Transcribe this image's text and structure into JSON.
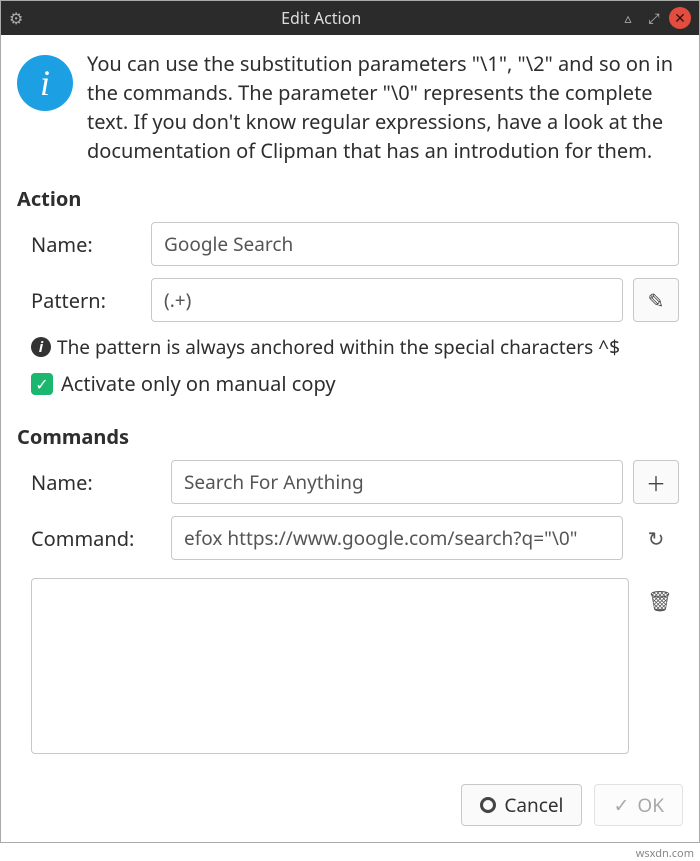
{
  "titlebar": {
    "title": "Edit Action"
  },
  "intro": {
    "text": "You can use the substitution parameters \"\\1\", \"\\2\" and so on in the commands. The parameter \"\\0\" represents the complete text. If you don't know regular expressions, have a look at the documentation of Clipman that has an introdution for them."
  },
  "action": {
    "header": "Action",
    "name_label": "Name:",
    "name_value": "Google Search",
    "pattern_label": "Pattern:",
    "pattern_value": "(.+)",
    "note": "The pattern is always anchored within the special characters ^$",
    "activate_label": "Activate only on manual copy",
    "activate_checked": true
  },
  "commands": {
    "header": "Commands",
    "name_label": "Name:",
    "name_value": "Search For Anything",
    "command_label": "Command:",
    "command_value": "efox https://www.google.com/search?q=\"\\0\""
  },
  "buttons": {
    "cancel": "Cancel",
    "ok": "OK"
  },
  "watermark": "wsxdn.com"
}
